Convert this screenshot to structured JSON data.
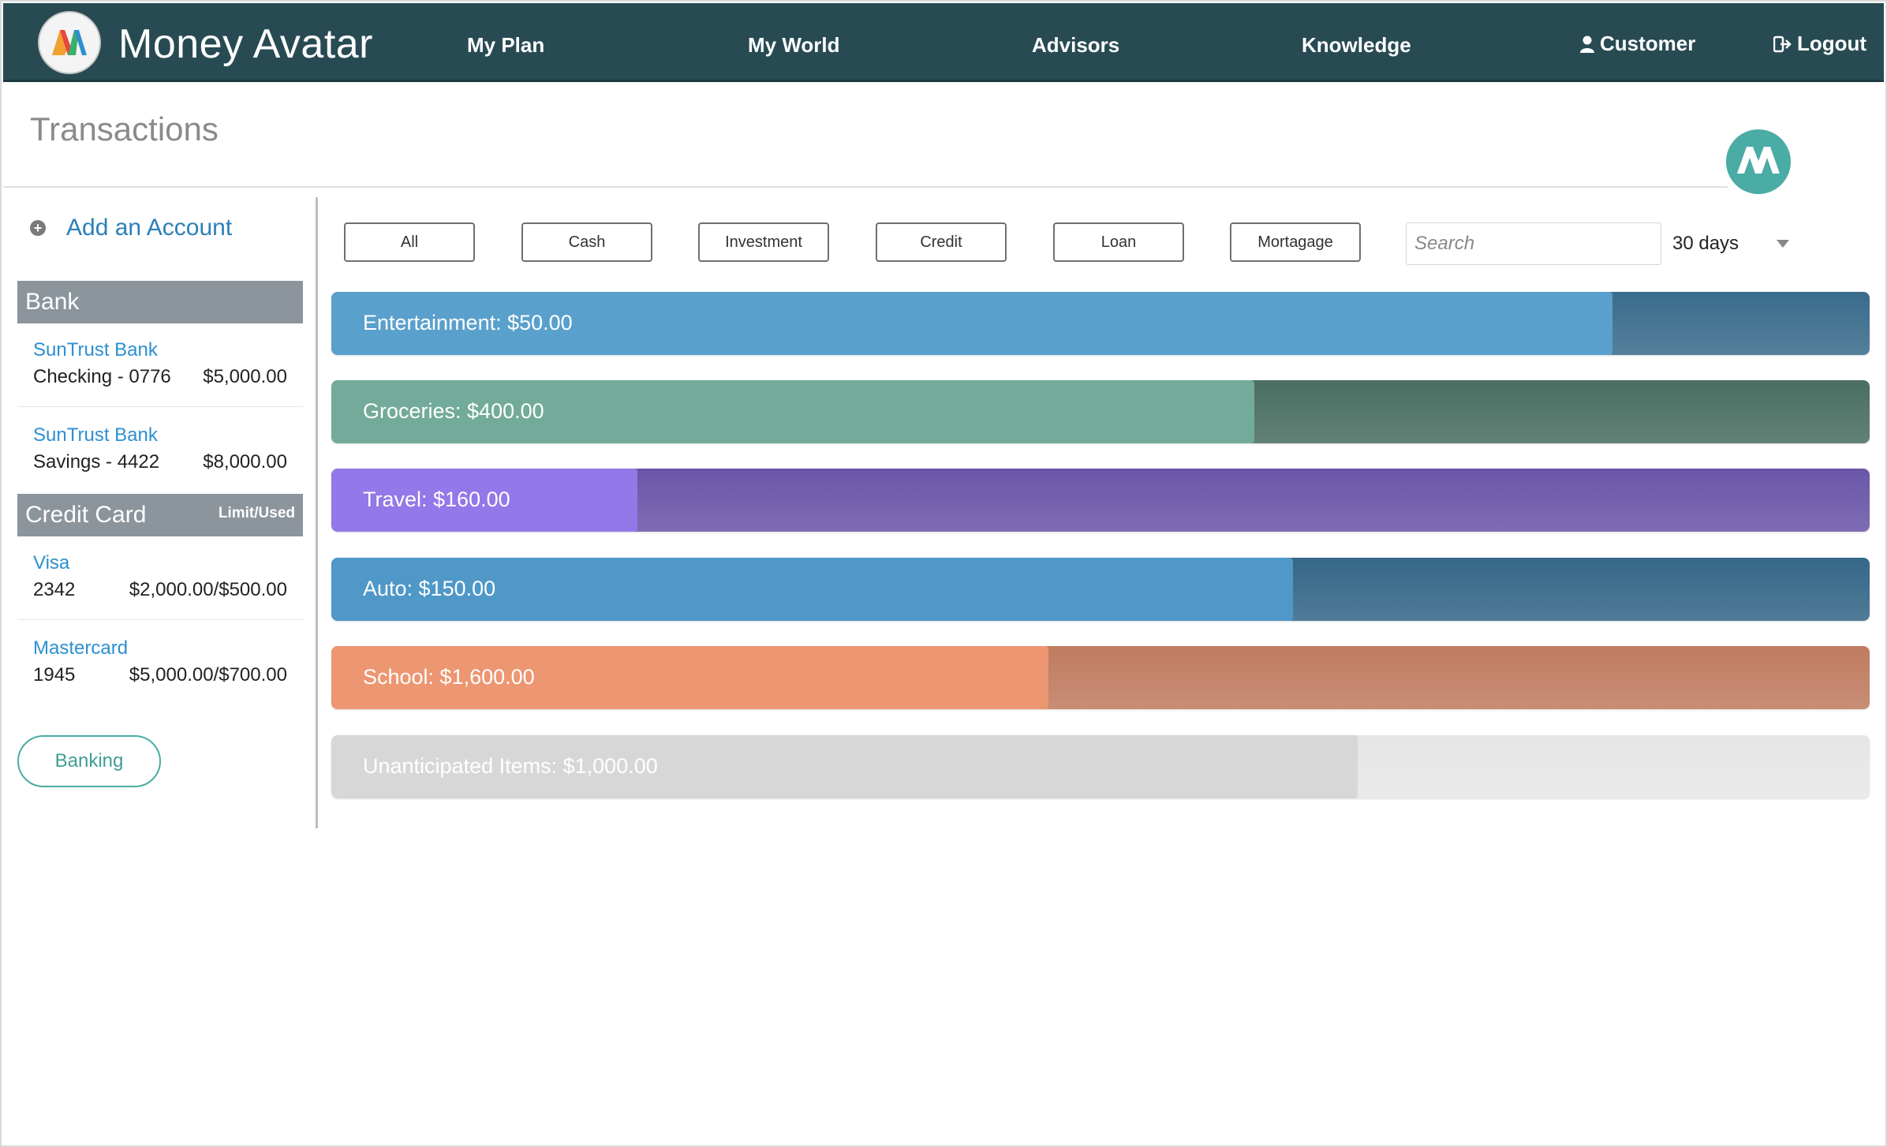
{
  "app": {
    "brand": "Money Avatar",
    "nav": [
      {
        "label": "My Plan"
      },
      {
        "label": "My World"
      },
      {
        "label": "Advisors"
      },
      {
        "label": "Knowledge"
      }
    ],
    "user_label": "Customer",
    "logout_label": "Logout"
  },
  "page": {
    "title": "Transactions"
  },
  "sidebar": {
    "add_account_label": "Add an Account",
    "bank_section": {
      "title": "Bank",
      "accounts": [
        {
          "bank": "SunTrust Bank",
          "desc": "Checking - 0776",
          "amount": "$5,000.00"
        },
        {
          "bank": "SunTrust Bank",
          "desc": "Savings - 4422",
          "amount": "$8,000.00"
        }
      ]
    },
    "credit_section": {
      "title": "Credit Card",
      "subtitle": "Limit/Used",
      "accounts": [
        {
          "bank": "Visa",
          "desc": "2342",
          "amount": "$2,000.00/$500.00"
        },
        {
          "bank": "Mastercard",
          "desc": "1945",
          "amount": "$5,000.00/$700.00"
        }
      ]
    },
    "banking_button": "Banking"
  },
  "filters": {
    "buttons": [
      "All",
      "Cash",
      "Investment",
      "Credit",
      "Loan",
      "Mortagage"
    ],
    "search_placeholder": "Search",
    "period": "30 days"
  },
  "categories": [
    {
      "label": "Entertainment: $50.00",
      "fill": 0.833,
      "fill_color": "#5aa0cc",
      "track_color": "#3a6c8c"
    },
    {
      "label": "Groceries: $400.00",
      "fill": 0.6,
      "fill_color": "#73ab9a",
      "track_color": "#4a6e62"
    },
    {
      "label": "Travel: $160.00",
      "fill": 0.199,
      "fill_color": "#9278e8",
      "track_color": "#6a56a8"
    },
    {
      "label": "Auto: $150.00",
      "fill": 0.625,
      "fill_color": "#4f98c8",
      "track_color": "#356788"
    },
    {
      "label": "School: $1,600.00",
      "fill": 0.466,
      "fill_color": "#ec9672",
      "track_color": "#bf7c60"
    },
    {
      "label": "Unanticipated Items: $1,000.00",
      "fill": 0.667,
      "fill_color": "#d7d7d7",
      "track_color": "#e6e6e6"
    }
  ]
}
